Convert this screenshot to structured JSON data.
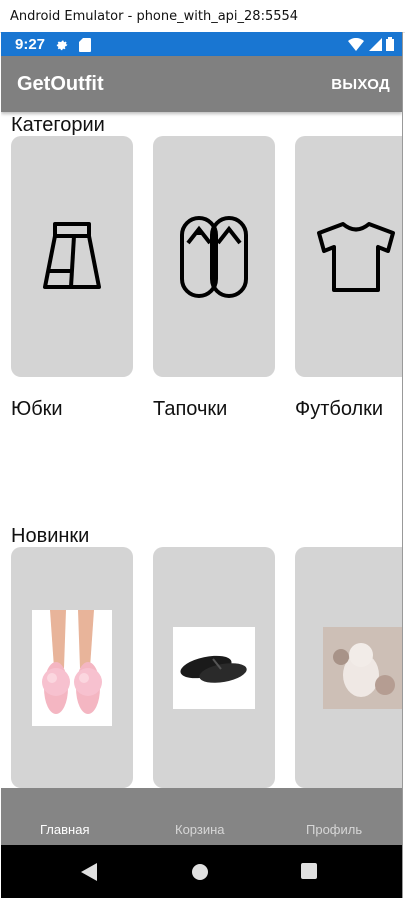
{
  "window": {
    "title": "Android Emulator - phone_with_api_28:5554"
  },
  "status_bar": {
    "time": "9:27",
    "left_icons": [
      "settings-icon",
      "sd-card-icon"
    ],
    "right_icons": [
      "wifi-icon",
      "signal-icon",
      "battery-icon"
    ]
  },
  "app_bar": {
    "title": "GetOutfit",
    "exit_label": "ВЫХОД"
  },
  "categories": {
    "title": "Категории",
    "items": [
      {
        "label": "Юбки",
        "icon": "skirt-icon"
      },
      {
        "label": "Тапочки",
        "icon": "slippers-icon"
      },
      {
        "label": "Футболки",
        "icon": "tshirt-icon"
      }
    ]
  },
  "new_items": {
    "title": "Новинки",
    "items": [
      {
        "image": "pink-fluffy-slippers-image"
      },
      {
        "image": "black-flip-flops-image"
      },
      {
        "image": "plush-toy-image"
      }
    ]
  },
  "bottom_nav": {
    "items": [
      {
        "label": "Главная",
        "active": true
      },
      {
        "label": "Корзина",
        "active": false
      },
      {
        "label": "Профиль",
        "active": false
      }
    ]
  },
  "system_nav": {
    "buttons": [
      "back-icon",
      "home-icon",
      "recents-icon"
    ]
  },
  "colors": {
    "status_bar": "#1976d2",
    "app_bar": "#808080",
    "card": "#d4d4d4",
    "bottom_nav": "#858585",
    "nav_active": "#ffffff",
    "nav_inactive": "#d6d6d6"
  }
}
